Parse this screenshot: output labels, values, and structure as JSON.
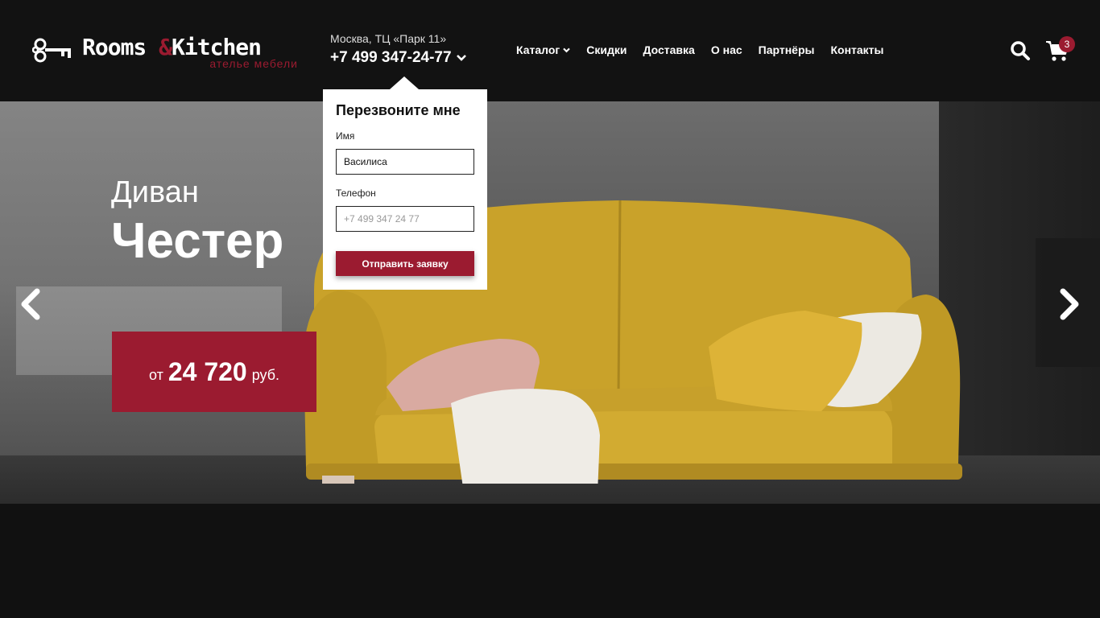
{
  "brand": {
    "name_part1": "Rooms ",
    "amp": "&",
    "name_part2": "Kitchen",
    "tagline": "ателье мебели"
  },
  "contact": {
    "address": "Москва, ТЦ «Парк 11»",
    "phone": "+7 499 347-24-77"
  },
  "nav": {
    "items": [
      {
        "label": "Каталог",
        "has_dropdown": true
      },
      {
        "label": "Скидки"
      },
      {
        "label": "Доставка"
      },
      {
        "label": "О нас"
      },
      {
        "label": "Партнёры"
      },
      {
        "label": "Контакты"
      }
    ]
  },
  "cart": {
    "count": "3"
  },
  "hero": {
    "subtitle": "Диван",
    "title": "Честер",
    "price_prefix": "от",
    "price_value": "24 720",
    "price_currency": "руб."
  },
  "callback": {
    "title": "Перезвоните мне",
    "name_label": "Имя",
    "name_value": "Василиса",
    "phone_label": "Телефон",
    "phone_placeholder": "+7 499 347 24 77",
    "submit_label": "Отправить заявку"
  },
  "colors": {
    "accent": "#9b1b30",
    "header_bg": "#121212",
    "sofa": "#c9a22a"
  },
  "icons": [
    "key-icon",
    "chevron-down-icon",
    "search-icon",
    "cart-icon",
    "arrow-left-icon",
    "arrow-right-icon"
  ]
}
